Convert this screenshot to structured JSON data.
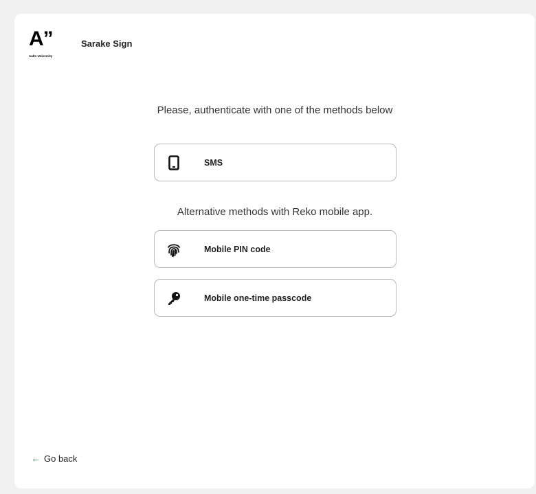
{
  "header": {
    "logo_mark": "A”",
    "logo_subtext": "Aalto University",
    "app_name": "Sarake Sign"
  },
  "prompt": "Please, authenticate with one of the methods below",
  "methods": [
    {
      "label": "SMS",
      "icon": "phone-icon"
    }
  ],
  "alternative_heading": "Alternative methods with Reko mobile app.",
  "alt_methods": [
    {
      "label": "Mobile PIN code",
      "icon": "fingerprint-icon"
    },
    {
      "label": "Mobile one-time passcode",
      "icon": "key-icon"
    }
  ],
  "footer": {
    "go_back_label": "Go back",
    "arrow": "←"
  },
  "colors": {
    "accent": "#2a7a4a",
    "border": "#b9b9b9",
    "background": "#f1f1f1"
  }
}
